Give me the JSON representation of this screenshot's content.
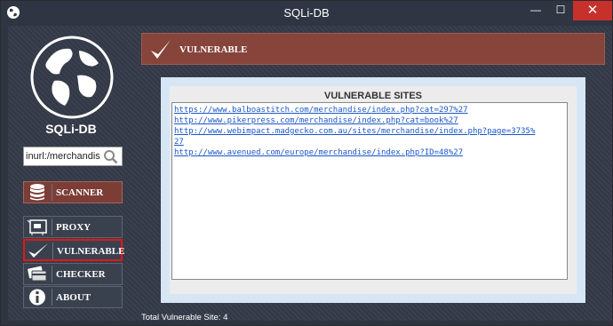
{
  "window": {
    "title": "SQLi-DB",
    "minimize_glyph": "—",
    "maximize_glyph": "☐",
    "close_glyph": "✕"
  },
  "sidebar": {
    "brand": "SQLi-DB",
    "search": {
      "value": "inurl:/merchandis",
      "icon": "magnifier-icon"
    },
    "scanner_label": "SCANNER",
    "items": [
      {
        "label": "PROXY",
        "icon": "proxy-card-icon"
      },
      {
        "label": "VULNERABLE",
        "icon": "checkmark-icon",
        "active": true
      },
      {
        "label": "CHECKER",
        "icon": "cards-icon"
      },
      {
        "label": "ABOUT",
        "icon": "info-icon"
      }
    ]
  },
  "header": {
    "title": "VULNERABLE"
  },
  "panel": {
    "title": "VULNERABLE SITES",
    "sites": [
      "https://www.balboastitch.com/merchandise/index.php?cat=297%27",
      "http://www.pikerpress.com/merchandise/index.php?cat=book%27",
      "http://www.webimpact.madgecko.com.au/sites/merchandise/index.php?page=3735%",
      "27",
      "http://www.avenued.com/europe/merchandise/index.php?ID=48%27"
    ]
  },
  "status": {
    "text": "Total Vulnerable Site:  4"
  },
  "colors": {
    "accent": "#87443b",
    "link": "#1a57c9",
    "close": "#c7312b",
    "highlight": "#e01818"
  }
}
